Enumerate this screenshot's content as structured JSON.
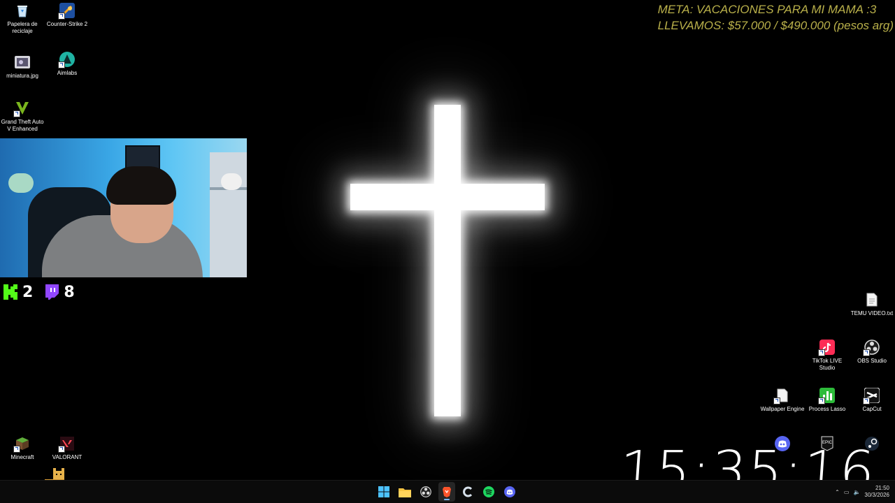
{
  "goal": {
    "line1": "META: VACACIONES PARA MI MAMA :3",
    "line2": "LLEVAMOS: $57.000 / $490.000 (pesos arg)"
  },
  "desktop_left": {
    "recycle": "Papelera de reciclaje",
    "cs2": "Counter-Strike 2",
    "miniatura": "miniatura.jpg",
    "aimlabs": "Aimlabs",
    "gta": "Grand Theft Auto V Enhanced",
    "minecraft": "Minecraft",
    "valorant": "VALORANT"
  },
  "desktop_right": {
    "temu": "TEMU VIDEO.txt",
    "tiktok": "TikTok LIVE Studio",
    "obs": "OBS Studio",
    "wallpaper": "Wallpaper Engine",
    "lasso": "Process Lasso",
    "capcut": "CapCut"
  },
  "viewers": {
    "kick": "2",
    "twitch": "8"
  },
  "clock": "15:35:16",
  "taskbar": {
    "icons": [
      "windows-start-icon",
      "file-explorer-icon",
      "obs-icon",
      "brave-browser-icon",
      "ccleaner-icon",
      "spotify-icon",
      "discord-icon"
    ],
    "time": "21:50",
    "date": "30/3/2026"
  },
  "colors": {
    "goal_text": "#b9b04a",
    "kick_green": "#53fc18",
    "twitch_purple": "#9146ff"
  }
}
